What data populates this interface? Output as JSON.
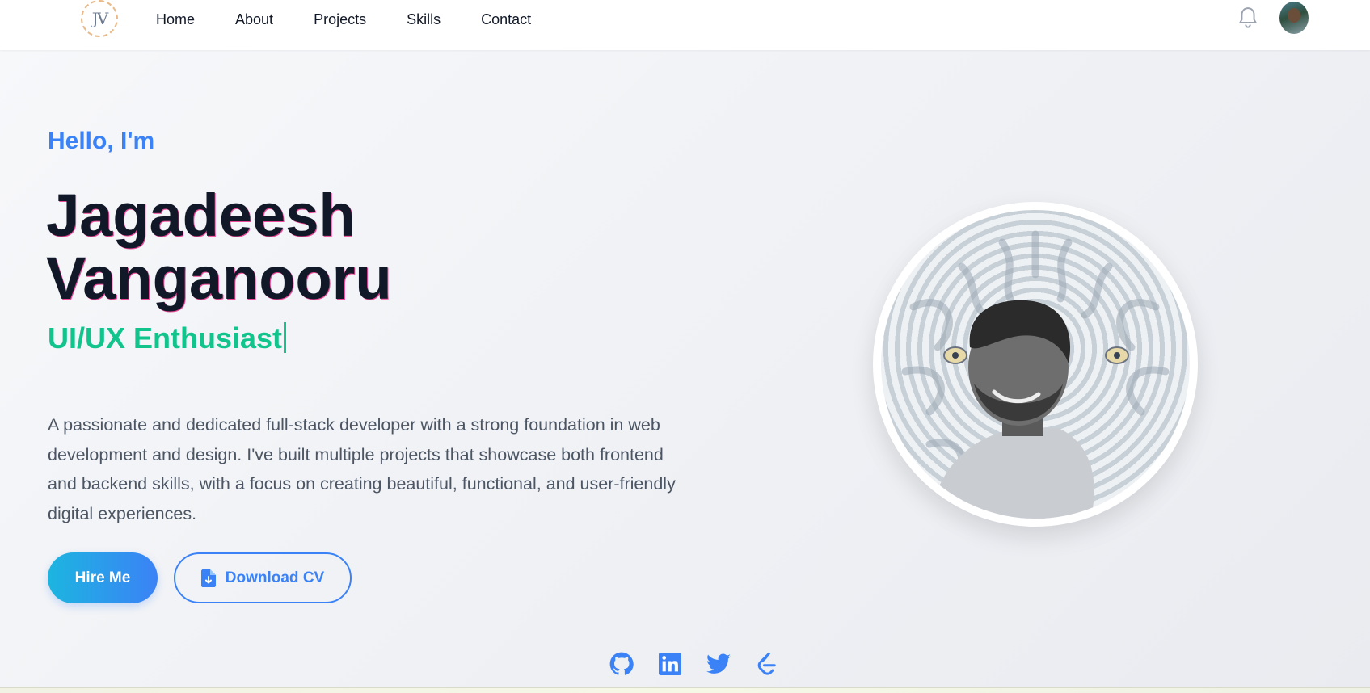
{
  "nav": {
    "logo_text": "JV",
    "links": [
      "Home",
      "About",
      "Projects",
      "Skills",
      "Contact"
    ],
    "icons": {
      "notification": "bell-icon",
      "profile": "avatar"
    }
  },
  "hero": {
    "greeting": "Hello, I'm",
    "name_line1": "Jagadeesh",
    "name_line2": "Vanganooru",
    "role": "UI/UX Enthusiast",
    "description": "A passionate and dedicated full-stack developer with a strong foundation in web development and design. I've built multiple projects that showcase both frontend and backend skills, with a focus on creating beautiful, functional, and user-friendly digital experiences.",
    "buttons": {
      "hire": "Hire Me",
      "cv": "Download CV"
    }
  },
  "social": [
    "github-icon",
    "linkedin-icon",
    "twitter-icon",
    "leetcode-icon"
  ],
  "colors": {
    "accent_blue": "#3b82f6",
    "accent_green": "#10c48c",
    "heading": "#111827",
    "body_text": "#4b5563"
  }
}
